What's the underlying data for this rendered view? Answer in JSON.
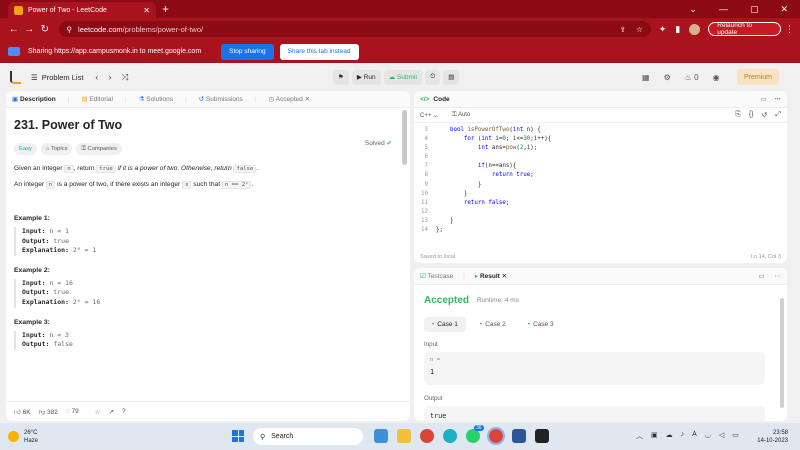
{
  "browser": {
    "tab_title": "Power of Two - LeetCode",
    "url_host": "leetcode.com",
    "url_path": "/problems/power-of-two/",
    "relaunch_label": "Relaunch to update"
  },
  "share_bar": {
    "message": "Sharing https://app.campusmonk.in to meet.google.com",
    "stop_label": "Stop sharing",
    "share_tab_label": "Share this tab instead"
  },
  "lc_nav": {
    "problem_list_label": "Problem List",
    "run_label": "Run",
    "submit_label": "Submit",
    "streak_count": "0",
    "premium_label": "Premium"
  },
  "left_tabs": {
    "description": "Description",
    "editorial": "Editorial",
    "solutions": "Solutions",
    "submissions": "Submissions",
    "accepted": "Accepted"
  },
  "problem": {
    "title": "231. Power of Two",
    "solved_label": "Solved",
    "difficulty": "Easy",
    "topics_label": "Topics",
    "companies_label": "Companies",
    "desc1_a": "Given an integer ",
    "desc1_n": "n",
    "desc1_b": ", return ",
    "desc1_true": "true",
    "desc1_c": " if it is a power of two. Otherwise, return ",
    "desc1_false": "false",
    "desc1_d": ".",
    "desc2_a": "An integer ",
    "desc2_n": "n",
    "desc2_b": " is a power of two, if there exists an integer ",
    "desc2_x": "x",
    "desc2_c": " such that ",
    "desc2_eq": "n == 2ˣ",
    "desc2_d": "."
  },
  "examples": [
    {
      "title": "Example 1:",
      "input": "n = 1",
      "output": "true",
      "explanation": "2⁰ = 1"
    },
    {
      "title": "Example 2:",
      "input": "n = 16",
      "output": "true",
      "explanation": "2⁴ = 16"
    },
    {
      "title": "Example 3:",
      "input": "n = 3",
      "output": "false"
    }
  ],
  "labels": {
    "input": "Input:",
    "output": "Output:",
    "explanation": "Explanation:"
  },
  "footer": {
    "likes": "6K",
    "dislikes": "382",
    "comments": "79"
  },
  "code_panel": {
    "tab": "Code",
    "language": "C++",
    "mode": "Auto",
    "saved": "Saved to local",
    "cursor": "Ln 14, Col 3",
    "lines": [
      {
        "n": "3",
        "t": "    bool isPowerOfTwo(int n) {"
      },
      {
        "n": "4",
        "t": "        for (int i=0; i<=30;i++){"
      },
      {
        "n": "5",
        "t": "            int ans=pow(2,i);"
      },
      {
        "n": "6",
        "t": ""
      },
      {
        "n": "7",
        "t": "            if(n==ans){"
      },
      {
        "n": "8",
        "t": "                return true;"
      },
      {
        "n": "9",
        "t": "            }"
      },
      {
        "n": "10",
        "t": "        }"
      },
      {
        "n": "11",
        "t": "        return false;"
      },
      {
        "n": "12",
        "t": ""
      },
      {
        "n": "13",
        "t": "    }"
      },
      {
        "n": "14",
        "t": "};"
      }
    ]
  },
  "result_panel": {
    "testcase_tab": "Testcase",
    "result_tab": "Result",
    "status": "Accepted",
    "runtime": "Runtime: 4 ms",
    "cases": [
      "Case 1",
      "Case 2",
      "Case 3"
    ],
    "input_label": "Input",
    "input_name": "n =",
    "input_value": "1",
    "output_label": "Output",
    "output_value": "true"
  },
  "taskbar": {
    "temp": "26°C",
    "weather": "Haze",
    "search": "Search",
    "time": "23:58",
    "date": "14-10-2023",
    "badge": "36"
  },
  "colors": {
    "chrome_red": "#a8131e",
    "accent_green": "#2cbb5d",
    "premium": "#c37d1d"
  }
}
